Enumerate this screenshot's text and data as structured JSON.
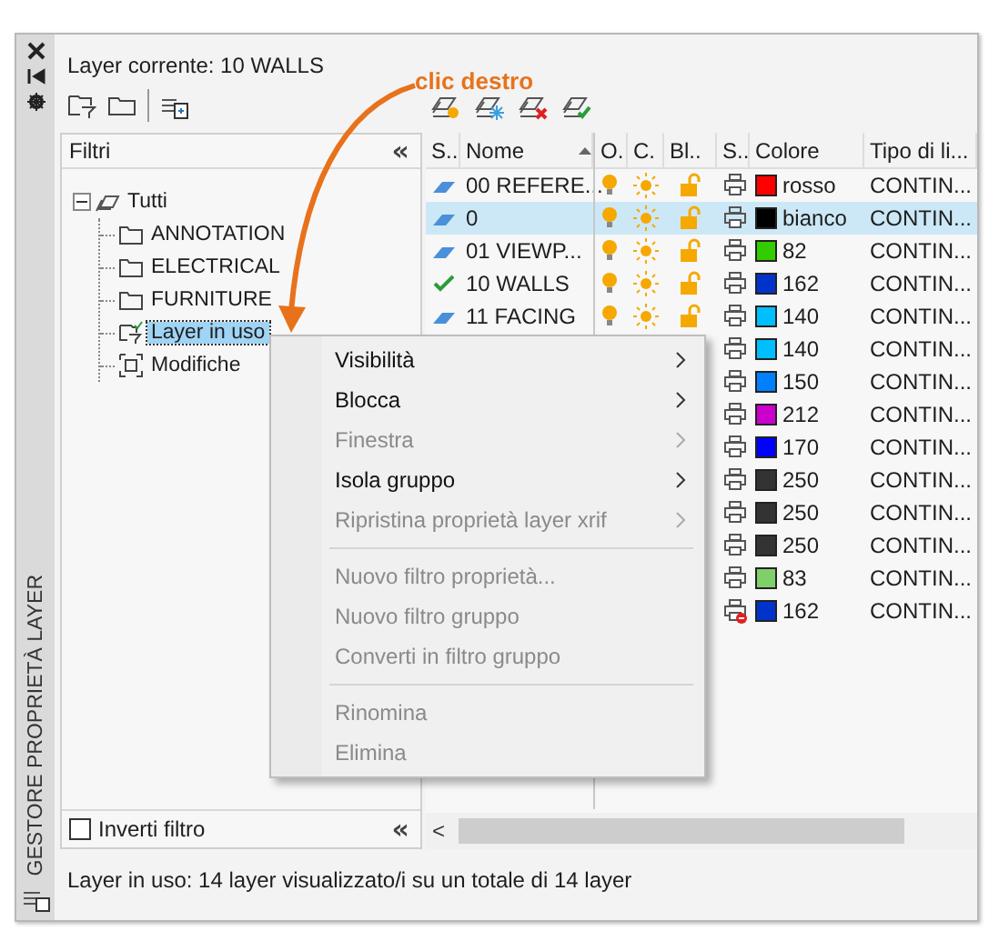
{
  "side_strip": {
    "title": "GESTORE PROPRIETÀ LAYER"
  },
  "current_layer": "Layer corrente: 10 WALLS",
  "annotation": {
    "text": "clic destro"
  },
  "filter_pane": {
    "header": "Filtri",
    "collapse": "«",
    "tree": [
      {
        "label": "Tutti",
        "kind": "all",
        "expanded": true,
        "selected": false,
        "children": [
          {
            "label": "ANNOTATION",
            "kind": "group",
            "selected": false
          },
          {
            "label": "ELECTRICAL",
            "kind": "group",
            "selected": false
          },
          {
            "label": "FURNITURE",
            "kind": "group",
            "selected": false
          },
          {
            "label": "Layer in uso",
            "kind": "property",
            "selected": true
          },
          {
            "label": "Modifiche",
            "kind": "changes",
            "selected": false
          }
        ]
      }
    ],
    "invert": {
      "label": "Inverti filtro",
      "checked": false
    },
    "footer_collapse": "«"
  },
  "table": {
    "columns": [
      "S..",
      "Nome",
      "O.",
      "C.",
      "Bl..",
      "S..",
      "Colore",
      "Tipo di li..."
    ],
    "rows": [
      {
        "current": false,
        "name": "00 REFERE...",
        "selected": false,
        "on": true,
        "frozen": false,
        "locked": false,
        "plot": true,
        "color": "#ff0000",
        "color_name": "rosso",
        "linetype": "CONTIN..."
      },
      {
        "current": false,
        "name": "0",
        "selected": true,
        "on": true,
        "frozen": false,
        "locked": false,
        "plot": true,
        "color": "#000000",
        "color_name": "bianco",
        "linetype": "CONTIN..."
      },
      {
        "current": false,
        "name": "01 VIEWP...",
        "selected": false,
        "on": true,
        "frozen": false,
        "locked": false,
        "plot": true,
        "color": "#33cc00",
        "color_name": "82",
        "linetype": "CONTIN..."
      },
      {
        "current": true,
        "name": "10 WALLS",
        "selected": false,
        "on": true,
        "frozen": false,
        "locked": false,
        "plot": true,
        "color": "#0033cc",
        "color_name": "162",
        "linetype": "CONTIN..."
      },
      {
        "current": false,
        "name": "11 FACING",
        "selected": false,
        "on": true,
        "frozen": false,
        "locked": false,
        "plot": true,
        "color": "#00bfff",
        "color_name": "140",
        "linetype": "CONTIN..."
      },
      {
        "plot": true,
        "color": "#00bfff",
        "color_name": "140",
        "linetype": "CONTIN..."
      },
      {
        "plot": true,
        "color": "#0080ff",
        "color_name": "150",
        "linetype": "CONTIN..."
      },
      {
        "plot": true,
        "color": "#cc00cc",
        "color_name": "212",
        "linetype": "CONTIN..."
      },
      {
        "plot": true,
        "color": "#0000ff",
        "color_name": "170",
        "linetype": "CONTIN..."
      },
      {
        "plot": true,
        "color": "#333333",
        "color_name": "250",
        "linetype": "CONTIN..."
      },
      {
        "plot": true,
        "color": "#333333",
        "color_name": "250",
        "linetype": "CONTIN..."
      },
      {
        "plot": true,
        "color": "#333333",
        "color_name": "250",
        "linetype": "CONTIN..."
      },
      {
        "plot": true,
        "color": "#80d06a",
        "color_name": "83",
        "linetype": "CONTIN..."
      },
      {
        "plot": false,
        "color": "#0033cc",
        "color_name": "162",
        "linetype": "CONTIN..."
      }
    ],
    "scroll_left": "<"
  },
  "status_bar": "Layer in uso: 14 layer visualizzato/i su un totale di 14 layer",
  "context_menu": [
    {
      "kind": "item",
      "label": "Visibilità",
      "disabled": false,
      "submenu": true
    },
    {
      "kind": "item",
      "label": "Blocca",
      "disabled": false,
      "submenu": true
    },
    {
      "kind": "item",
      "label": "Finestra",
      "disabled": true,
      "submenu": true
    },
    {
      "kind": "item",
      "label": "Isola gruppo",
      "disabled": false,
      "submenu": true
    },
    {
      "kind": "item",
      "label": "Ripristina proprietà layer xrif",
      "disabled": true,
      "submenu": true
    },
    {
      "kind": "separator"
    },
    {
      "kind": "item",
      "label": "Nuovo filtro proprietà...",
      "disabled": true,
      "submenu": false
    },
    {
      "kind": "item",
      "label": "Nuovo filtro gruppo",
      "disabled": true,
      "submenu": false
    },
    {
      "kind": "item",
      "label": "Converti in filtro gruppo",
      "disabled": true,
      "submenu": false
    },
    {
      "kind": "separator"
    },
    {
      "kind": "item",
      "label": "Rinomina",
      "disabled": true,
      "submenu": false
    },
    {
      "kind": "item",
      "label": "Elimina",
      "disabled": true,
      "submenu": false
    }
  ]
}
